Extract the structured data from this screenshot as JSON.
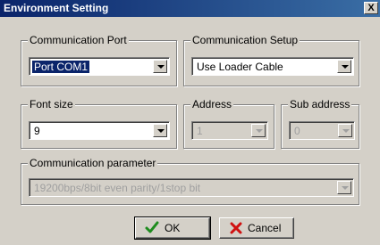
{
  "window": {
    "title": "Environment Setting",
    "close_label": "X"
  },
  "comm_port": {
    "legend": "Communication Port",
    "value": "Port COM1"
  },
  "comm_setup": {
    "legend": "Communication Setup",
    "value": "Use Loader Cable"
  },
  "font_size": {
    "legend": "Font size",
    "value": "9"
  },
  "address": {
    "legend": "Address",
    "value": "1"
  },
  "sub_address": {
    "legend": "Sub address",
    "value": "0"
  },
  "comm_param": {
    "legend": "Communication parameter",
    "value": "19200bps/8bit even parity/1stop bit"
  },
  "buttons": {
    "ok": "OK",
    "cancel": "Cancel"
  },
  "icons": {
    "ok": "check-icon",
    "cancel": "x-icon"
  },
  "colors": {
    "ok_check": "#1e8c1e",
    "cancel_x": "#d01010",
    "title_bar": "#0a246a",
    "dialog_bg": "#d4d0c8"
  }
}
